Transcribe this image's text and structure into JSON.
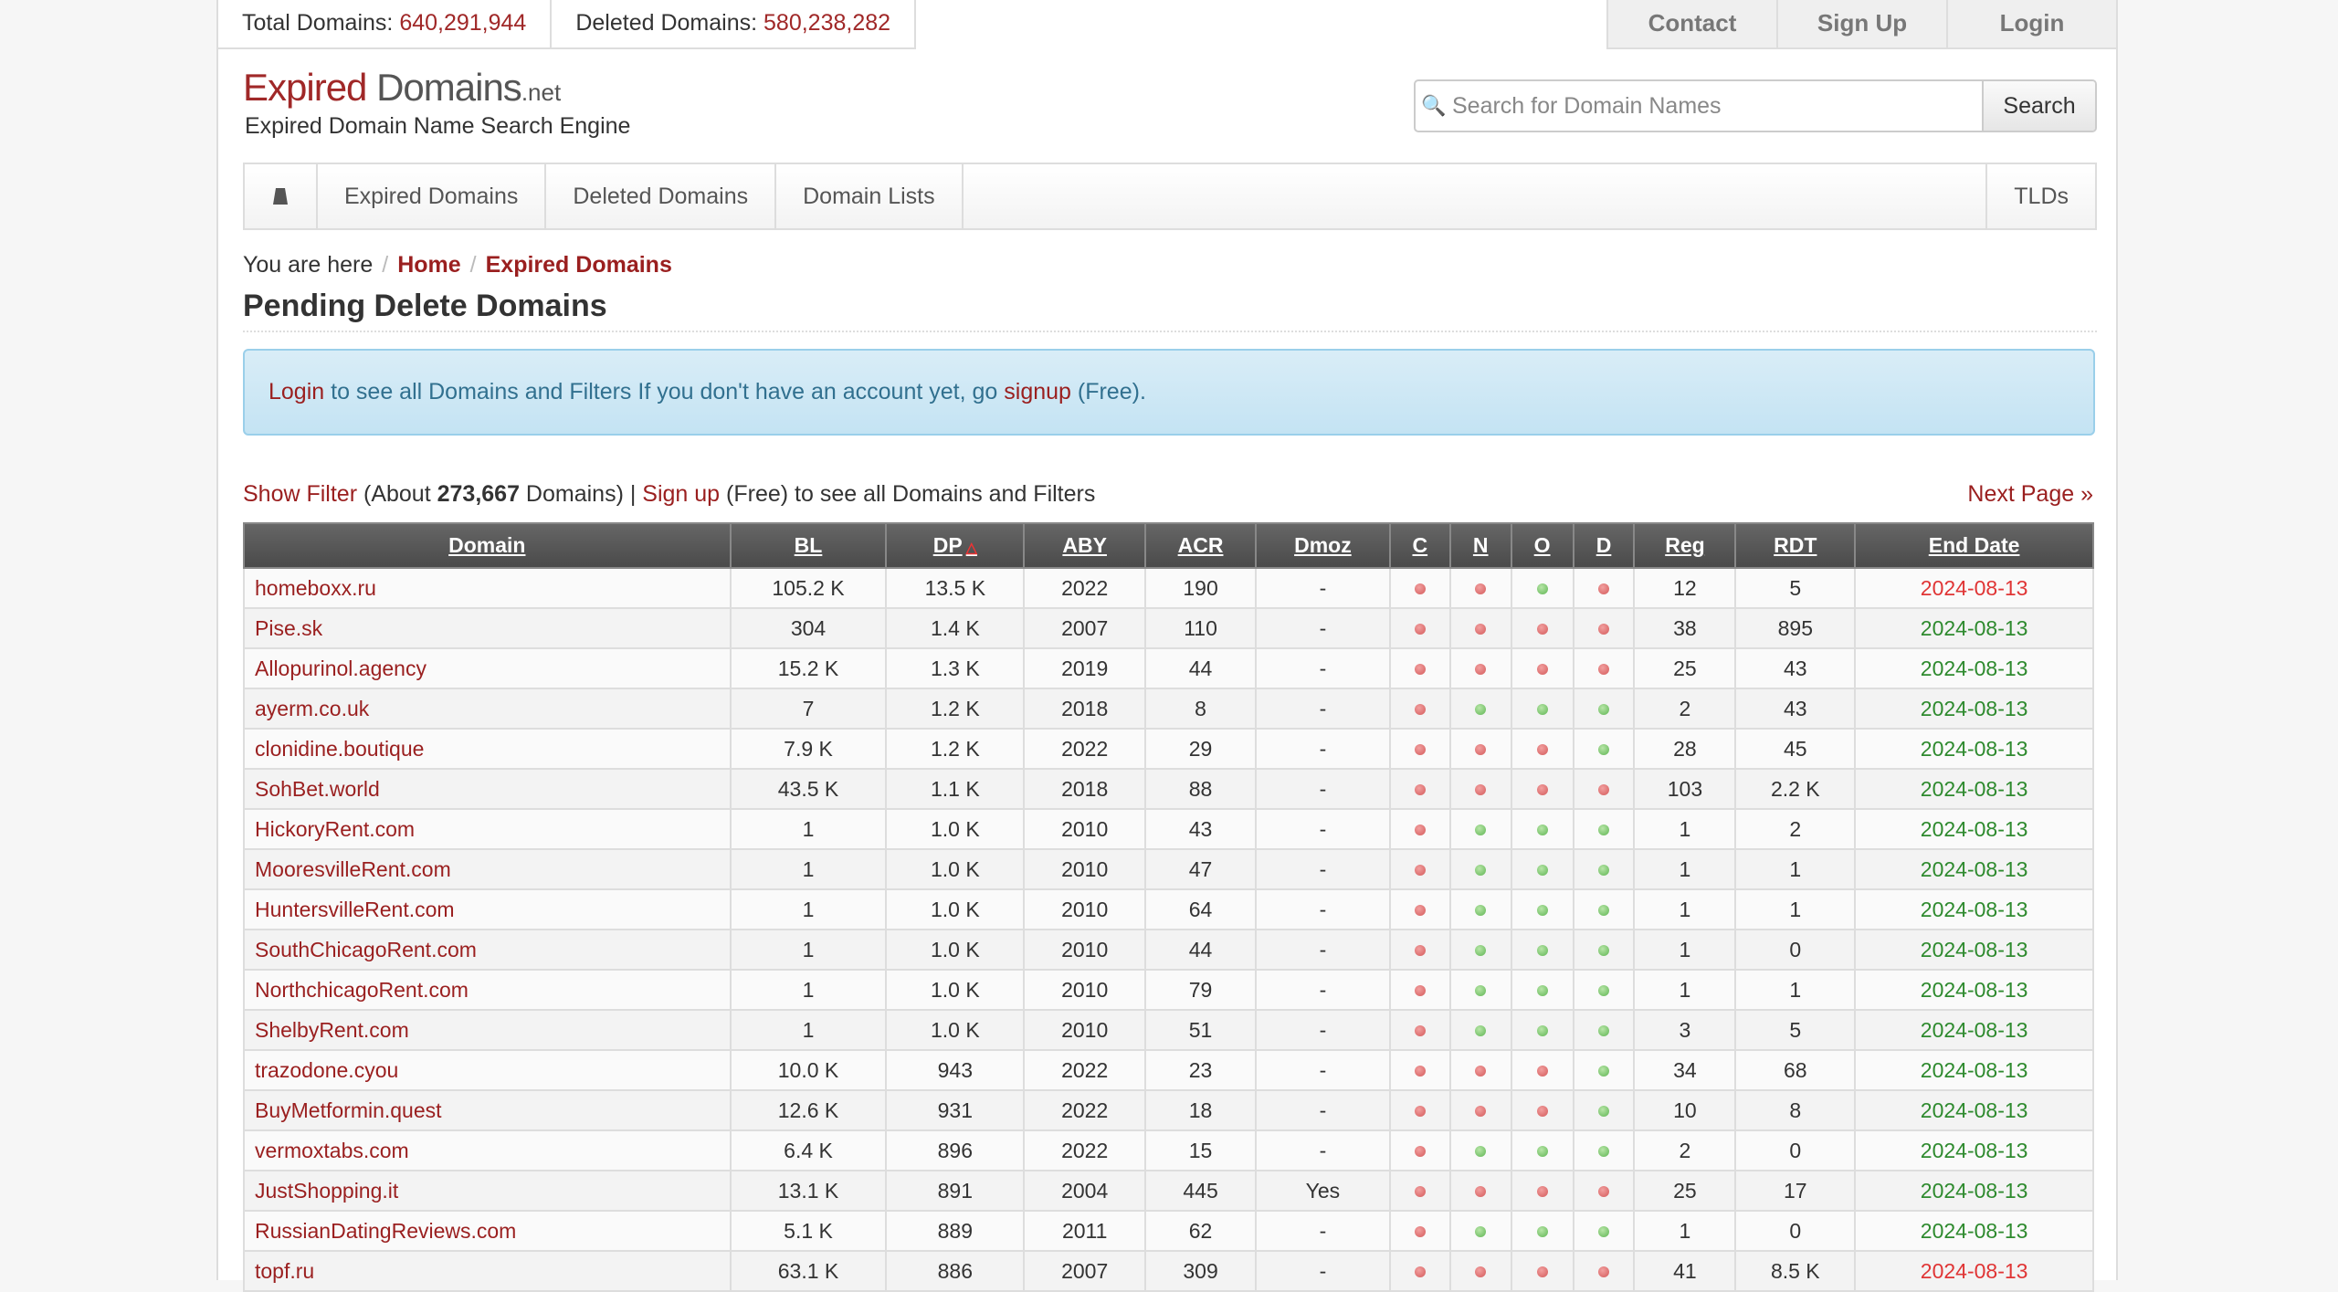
{
  "stats": {
    "total_label": "Total Domains:",
    "total_value": "640,291,944",
    "deleted_label": "Deleted Domains:",
    "deleted_value": "580,238,282"
  },
  "account": {
    "contact": "Contact",
    "signup": "Sign Up",
    "login": "Login"
  },
  "logo": {
    "expired": "Expired",
    "domains": " Domains",
    "net": ".net",
    "tagline": "Expired Domain Name Search Engine"
  },
  "search": {
    "placeholder": "Search for Domain Names",
    "button": "Search"
  },
  "nav": {
    "items": [
      "Expired Domains",
      "Deleted Domains",
      "Domain Lists"
    ],
    "tlds": "TLDs"
  },
  "breadcrumb": {
    "prefix": "You are here",
    "home": "Home",
    "current": "Expired Domains"
  },
  "page_title": "Pending Delete Domains",
  "alert": {
    "login": "Login",
    "text1": " to see all Domains and Filters If you don't have an account yet, go ",
    "signup": "signup",
    "text2": " (Free)."
  },
  "filter": {
    "show": "Show Filter",
    "about": " (About ",
    "count": "273,667",
    "domains": " Domains) | ",
    "signup": "Sign up",
    "rest": " (Free) to see all Domains and Filters",
    "next": "Next Page »"
  },
  "colors": {
    "accent": "#a02828",
    "ok": "#5fb553",
    "bad": "#d45a5a"
  },
  "table": {
    "headers": [
      "Domain",
      "BL",
      "DP",
      "ABY",
      "ACR",
      "Dmoz",
      "C",
      "N",
      "O",
      "D",
      "Reg",
      "RDT",
      "End Date"
    ],
    "rows": [
      [
        "homeboxx.ru",
        "105.2 K",
        "13.5 K",
        "2022",
        "190",
        "-",
        "r",
        "r",
        "g",
        "r",
        "12",
        "5",
        "2024-08-13",
        "r"
      ],
      [
        "Pise.sk",
        "304",
        "1.4 K",
        "2007",
        "110",
        "-",
        "r",
        "r",
        "r",
        "r",
        "38",
        "895",
        "2024-08-13",
        "g"
      ],
      [
        "Allopurinol.agency",
        "15.2 K",
        "1.3 K",
        "2019",
        "44",
        "-",
        "r",
        "r",
        "r",
        "r",
        "25",
        "43",
        "2024-08-13",
        "g"
      ],
      [
        "ayerm.co.uk",
        "7",
        "1.2 K",
        "2018",
        "8",
        "-",
        "r",
        "g",
        "g",
        "g",
        "2",
        "43",
        "2024-08-13",
        "g"
      ],
      [
        "clonidine.boutique",
        "7.9 K",
        "1.2 K",
        "2022",
        "29",
        "-",
        "r",
        "r",
        "r",
        "g",
        "28",
        "45",
        "2024-08-13",
        "g"
      ],
      [
        "SohBet.world",
        "43.5 K",
        "1.1 K",
        "2018",
        "88",
        "-",
        "r",
        "r",
        "r",
        "r",
        "103",
        "2.2 K",
        "2024-08-13",
        "g"
      ],
      [
        "HickoryRent.com",
        "1",
        "1.0 K",
        "2010",
        "43",
        "-",
        "r",
        "g",
        "g",
        "g",
        "1",
        "2",
        "2024-08-13",
        "g"
      ],
      [
        "MooresvilleRent.com",
        "1",
        "1.0 K",
        "2010",
        "47",
        "-",
        "r",
        "g",
        "g",
        "g",
        "1",
        "1",
        "2024-08-13",
        "g"
      ],
      [
        "HuntersvilleRent.com",
        "1",
        "1.0 K",
        "2010",
        "64",
        "-",
        "r",
        "g",
        "g",
        "g",
        "1",
        "1",
        "2024-08-13",
        "g"
      ],
      [
        "SouthChicagoRent.com",
        "1",
        "1.0 K",
        "2010",
        "44",
        "-",
        "r",
        "g",
        "g",
        "g",
        "1",
        "0",
        "2024-08-13",
        "g"
      ],
      [
        "NorthchicagoRent.com",
        "1",
        "1.0 K",
        "2010",
        "79",
        "-",
        "r",
        "g",
        "g",
        "g",
        "1",
        "1",
        "2024-08-13",
        "g"
      ],
      [
        "ShelbyRent.com",
        "1",
        "1.0 K",
        "2010",
        "51",
        "-",
        "r",
        "g",
        "g",
        "g",
        "3",
        "5",
        "2024-08-13",
        "g"
      ],
      [
        "trazodone.cyou",
        "10.0 K",
        "943",
        "2022",
        "23",
        "-",
        "r",
        "r",
        "r",
        "g",
        "34",
        "68",
        "2024-08-13",
        "g"
      ],
      [
        "BuyMetformin.quest",
        "12.6 K",
        "931",
        "2022",
        "18",
        "-",
        "r",
        "r",
        "r",
        "g",
        "10",
        "8",
        "2024-08-13",
        "g"
      ],
      [
        "vermoxtabs.com",
        "6.4 K",
        "896",
        "2022",
        "15",
        "-",
        "r",
        "g",
        "g",
        "g",
        "2",
        "0",
        "2024-08-13",
        "g"
      ],
      [
        "JustShopping.it",
        "13.1 K",
        "891",
        "2004",
        "445",
        "Yes",
        "r",
        "r",
        "r",
        "r",
        "25",
        "17",
        "2024-08-13",
        "g"
      ],
      [
        "RussianDatingReviews.com",
        "5.1 K",
        "889",
        "2011",
        "62",
        "-",
        "r",
        "g",
        "g",
        "g",
        "1",
        "0",
        "2024-08-13",
        "g"
      ],
      [
        "topf.ru",
        "63.1 K",
        "886",
        "2007",
        "309",
        "-",
        "r",
        "r",
        "r",
        "r",
        "41",
        "8.5 K",
        "2024-08-13",
        "r"
      ]
    ]
  }
}
